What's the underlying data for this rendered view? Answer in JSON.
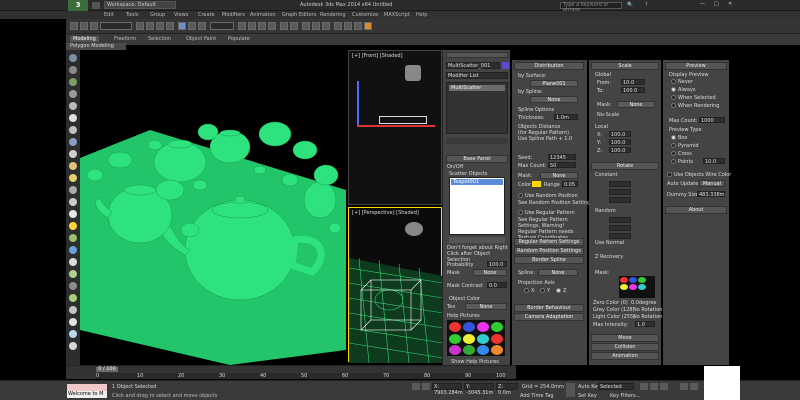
{
  "window": {
    "title": "Autodesk 3ds Max 2014 x64    Untitled",
    "workspace": "Workspace: Default",
    "search_placeholder": "Type a keyword or phrase"
  },
  "menu": [
    "Edit",
    "Tools",
    "Group",
    "Views",
    "Create",
    "Modifiers",
    "Animation",
    "Graph Editors",
    "Rendering",
    "Customize",
    "MAXScript",
    "Help"
  ],
  "ribbon": {
    "tabs": [
      "Modeling",
      "Freeform",
      "Selection",
      "Object Paint",
      "Populate"
    ],
    "active_tab": "Modeling",
    "subtab": "Polygon Modeling"
  },
  "viewports": {
    "top_label": "[+] [Front] [Shaded]",
    "persp_label": "[+] [Perspective] [Shaded]"
  },
  "command_panel": {
    "object_name": "MultiScatter_001",
    "modifier_list": "Modifier List",
    "stack_item": "MultiScatter",
    "base_panel": "Base Panel",
    "on_off": "On/Off",
    "scatter_objects": "Scatter Objects",
    "selected_item": "Teapot001",
    "note": "Don't forget about Right Click after Object Selection",
    "probability_label": "Probability",
    "probability": "100.0",
    "mask_label": "Mask",
    "mask_value": "None",
    "mask_contrast_label": "Mask Contrast",
    "mask_contrast": "0.0",
    "object_color": "Object Color",
    "tex_label": "Tex",
    "tex_value": "None",
    "help_pictures": "Help Pictures",
    "show_help": "Show Help Pictures"
  },
  "distribution": {
    "header": "Distribution",
    "by_surface": "by Surface:",
    "surface_obj": "Plane001",
    "by_spline": "by Spline:",
    "spline_val": "None",
    "spline_options": "Spline Options",
    "thickness_label": "Thickness:",
    "thickness": "1.0m",
    "obj_dist": "Objects Distance",
    "regular_pattern": "(for Regular Pattern)",
    "use_spline": "Use Spline Path + 1.0",
    "seed_label": "Seed:",
    "seed": "12345",
    "max_count_label": "Max Count:",
    "max_count": "50",
    "mask_label": "Mask:",
    "mask": "None",
    "color_label": "Color",
    "range_label": "Range",
    "range": "0.05",
    "use_random": "Use Random Position",
    "see_random": "See Random Position Settings.",
    "use_regular": "Use Regular Pattern",
    "see_regular": "See Regular Pattern Settings. Warning! Regular Pattern needs Texture Coordinates",
    "regular_pattern_settings": "Regular Pattern Settings",
    "random_position_settings": "Random Position Settings",
    "border_spline": "Border Spline",
    "spline_label": "Spline:",
    "spline_none": "None",
    "projection_axis": "Projection Axis",
    "x": "X",
    "y": "Y",
    "z": "Z",
    "border_behaviour": "Border Behaviour",
    "camera_adaptation": "Camera Adaptation"
  },
  "scale": {
    "header": "Scale",
    "global": "Global",
    "from_label": "From:",
    "from": "10.0",
    "to_label": "To:",
    "to": "100.0",
    "mask_label": "Mask:",
    "mask": "None",
    "no_scale": "No-Scale",
    "local": "Local",
    "x": "X:",
    "y": "Y:",
    "z": "Z:",
    "xv": "100.0",
    "yv": "100.0",
    "zv": "100.0"
  },
  "rotate": {
    "header": "Rotate",
    "constant": "Constant",
    "random": "Random",
    "use_normal": "Use Normal",
    "z_recovery": "Z Recovery"
  },
  "preview": {
    "header": "Preview",
    "display_preview": "Display Preview",
    "never": "Never",
    "always": "Always",
    "when_selected": "When Selected",
    "when_rendering": "When Rendering",
    "max_count_label": "Max Count:",
    "max_count": "1000",
    "preview_type": "Preview Type",
    "box": "Box",
    "pyramid": "Pyramid",
    "cross": "Cross",
    "points": "Points",
    "points_val": "10.0",
    "use_wire": "Use Objects Wire Color",
    "auto_update": "Auto Update",
    "manual": "Manual",
    "dummy_size_label": "Dummy Size:",
    "dummy_size": "483.338m",
    "about": "About"
  },
  "mask_section": {
    "mask_label": "Mask:",
    "zero_color": "Zero Color (0)",
    "zero_val": "0.0degree",
    "color128": "Grey Color (128)",
    "color128_val": "No Rotation",
    "light_color": "Light Color (255)",
    "light_val": "No Rotation",
    "max_intensity_label": "Max Intensity:",
    "max_intensity": "1.0",
    "move": "Move",
    "collision": "Collision",
    "animation": "Animation"
  },
  "timeline": {
    "frame": "0 / 100",
    "ticks": [
      "0",
      "10",
      "20",
      "30",
      "40",
      "50",
      "60",
      "70",
      "80",
      "90",
      "100"
    ]
  },
  "status": {
    "listener": "Welcome to M",
    "objects_selected": "1 Object Selected",
    "hint": "Click and drag to select and move objects",
    "x": "X: 7903.284m",
    "y": "Y: -3045.31m",
    "z": "Z: 0.0m",
    "grid": "Grid = 254.0mm",
    "add_time_tag": "Add Time Tag",
    "auto_key": "Auto Key",
    "set_key": "Set Key",
    "selected": "Selected",
    "key_filters": "Key Filters..."
  },
  "colors": {
    "teapot_green": "#29e07a",
    "ground_green": "#22c56a",
    "accent_yellow": "#ffd700"
  }
}
